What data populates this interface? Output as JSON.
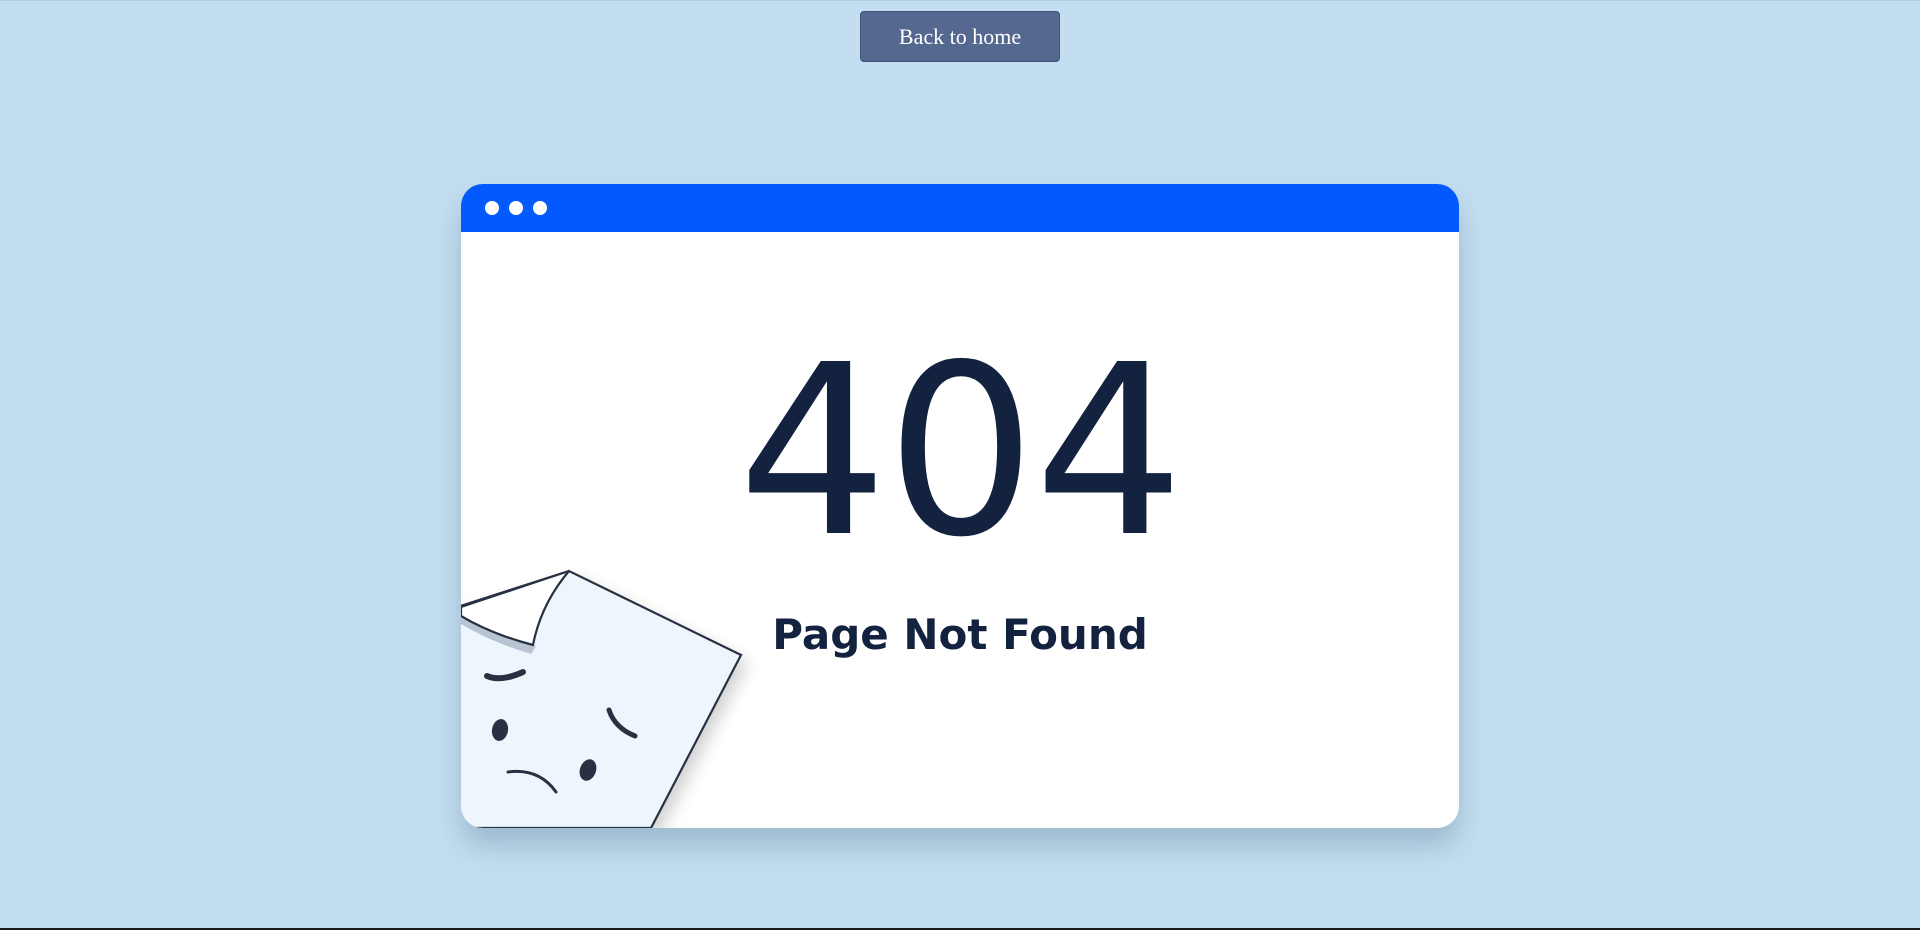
{
  "header": {
    "back_button_label": "Back to home"
  },
  "error_card": {
    "code": "404",
    "message": "Page Not Found",
    "icons": {
      "window_dots": "window-dots-icon",
      "illustration": "sad-page-icon"
    }
  },
  "colors": {
    "background": "#c3def0",
    "button": "#546890",
    "titlebar": "#0259fe",
    "text_dark": "#13223f",
    "card": "#ffffff"
  }
}
